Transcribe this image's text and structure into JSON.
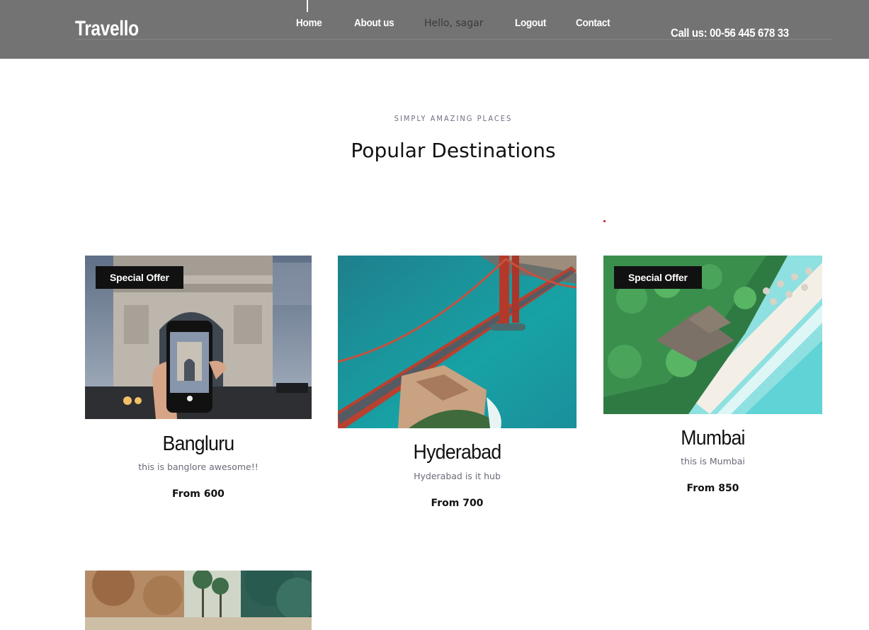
{
  "header": {
    "logo": "Travello",
    "nav": [
      "Home",
      "About us",
      "Hello, sagar",
      "Logout",
      "Contact"
    ],
    "phone": "Call us: 00-56 445 678 33"
  },
  "section": {
    "kicker": "SIMPLY AMAZING PLACES",
    "title": "Popular Destinations"
  },
  "destinations": [
    {
      "name": "Bangluru",
      "desc": "this is banglore awesome!!",
      "price": "From 600",
      "badge": "Special Offer"
    },
    {
      "name": "Hyderabad",
      "desc": "Hyderabad is it hub",
      "price": "From 700",
      "badge": ""
    },
    {
      "name": "Mumbai",
      "desc": "this is Mumbai",
      "price": "From 850",
      "badge": "Special Offer"
    }
  ]
}
